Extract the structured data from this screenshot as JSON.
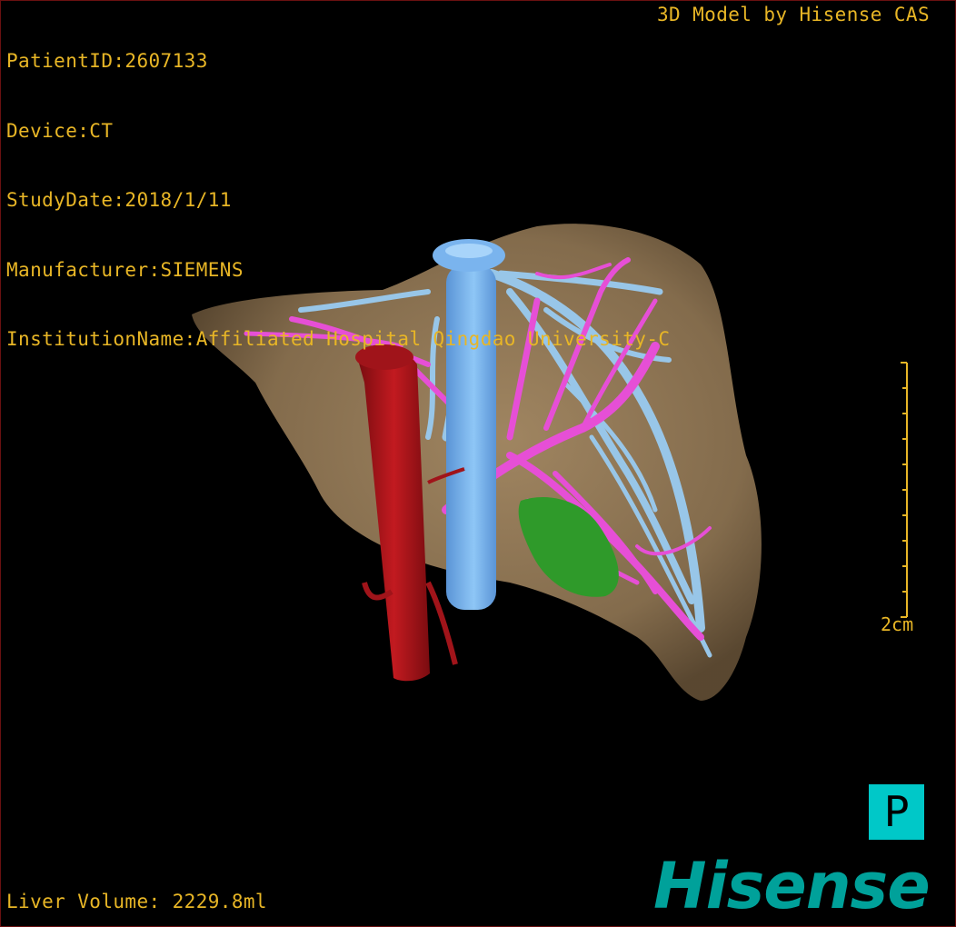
{
  "patient": {
    "id_line": "PatientID:2607133",
    "device_line": "Device:CT",
    "study_date_line": "StudyDate:2018/1/11",
    "manufacturer_line": "Manufacturer:SIEMENS",
    "institution_line": "InstitutionName:Affiliated Hospital Qingdao University-C"
  },
  "credit": "3D Model by Hisense CAS",
  "liver_volume": "Liver Volume: 2229.8ml",
  "scale_bar": {
    "label": "2cm"
  },
  "orientation": {
    "label": "P"
  },
  "brand": "Hisense",
  "colors": {
    "overlay_text": "#e8b626",
    "liver": "#8a7150",
    "hepatic_vein": "#8fbde0",
    "portal_vein": "#e64fd6",
    "ivc": "#7ab4ee",
    "aorta": "#b0141a",
    "lesion": "#2f9a2a",
    "orientation_box": "#00c8c8",
    "brand": "#00a19a"
  },
  "icons": {
    "orientation": "orientation-cube-icon",
    "brand": "hisense-logo"
  }
}
